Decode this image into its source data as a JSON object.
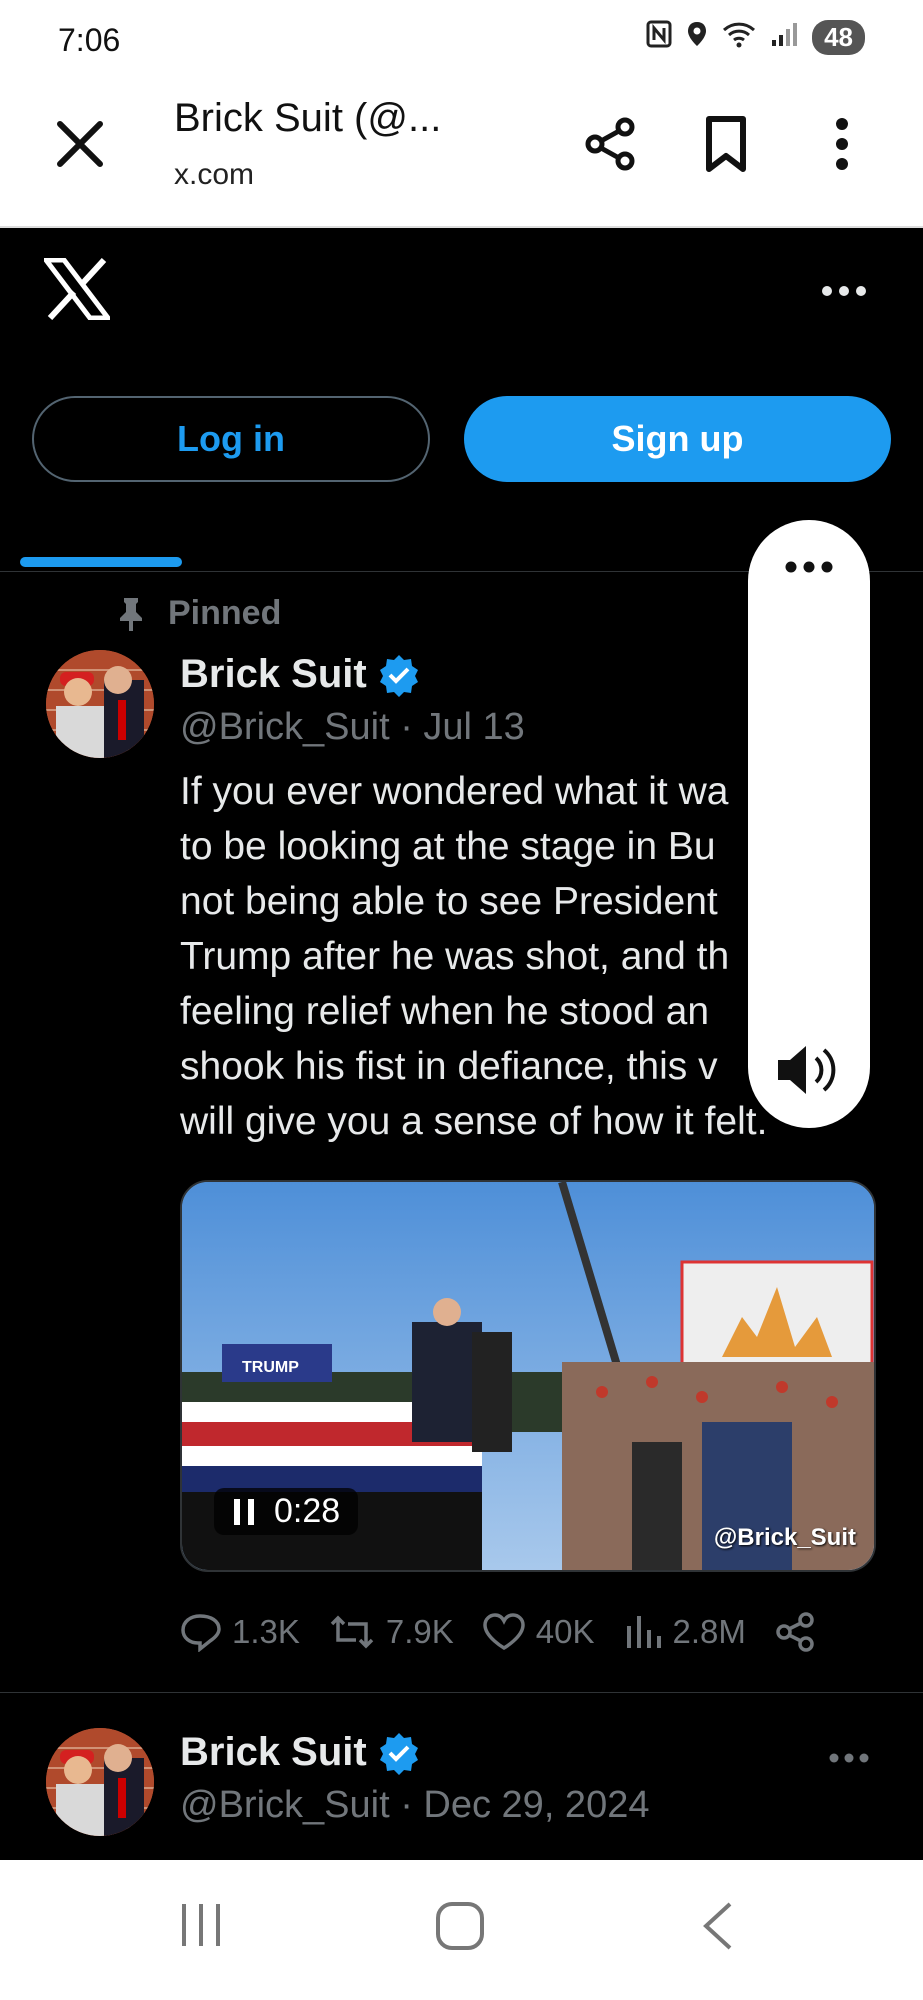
{
  "status": {
    "time": "7:06",
    "battery": "48"
  },
  "browser": {
    "title": "Brick Suit (@...",
    "url": "x.com"
  },
  "x_header": {
    "login_label": "Log in",
    "signup_label": "Sign up"
  },
  "pinned_tweet": {
    "pinned_label": "Pinned",
    "name": "Brick Suit",
    "handle": "@Brick_Suit",
    "date": "· Jul 13",
    "text": "If you ever wondered what it wa\nto be looking at the stage in Bu\nnot being able to see President\nTrump after he was shot, and th\nfeeling relief when he stood an\nshook his fist in defiance, this v\nwill give you a sense of how it felt.",
    "video": {
      "time": "0:28",
      "watermark": "@Brick_Suit",
      "sign_text": "TRUMP"
    },
    "stats": {
      "replies": "1.3K",
      "reposts": "7.9K",
      "likes": "40K",
      "views": "2.8M"
    }
  },
  "second_tweet": {
    "name": "Brick Suit",
    "handle": "@Brick_Suit",
    "date": "· Dec 29, 2024"
  },
  "colors": {
    "accent": "#1d9bf0",
    "background": "#000000",
    "muted": "#71767b"
  }
}
